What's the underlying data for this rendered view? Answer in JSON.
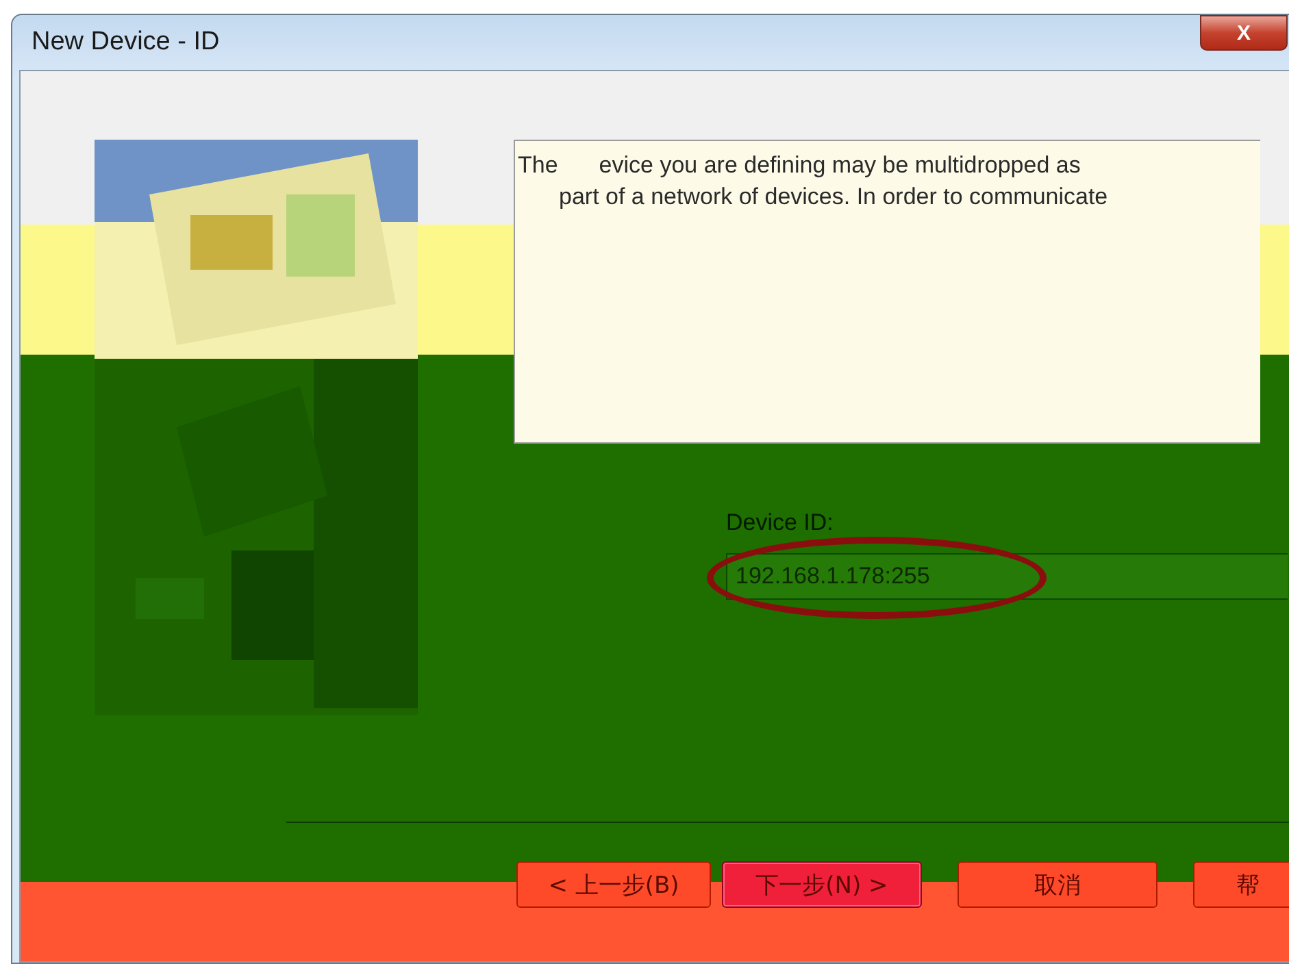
{
  "window": {
    "title": "New Device - ID",
    "close_label": "X"
  },
  "description": {
    "lines": [
      "The",
      "evice you are defining may be multidropped as",
      "part of a network of devices.  In order to communicate"
    ]
  },
  "device_id": {
    "label": "Device ID:",
    "value": "192.168.1.178:255"
  },
  "buttons": [
    {
      "label": "< 上一步(B)",
      "selected": false
    },
    {
      "label": "下一步(N) >",
      "selected": true
    },
    {
      "label": "取消",
      "selected": false
    },
    {
      "label": "帮",
      "selected": false
    }
  ]
}
